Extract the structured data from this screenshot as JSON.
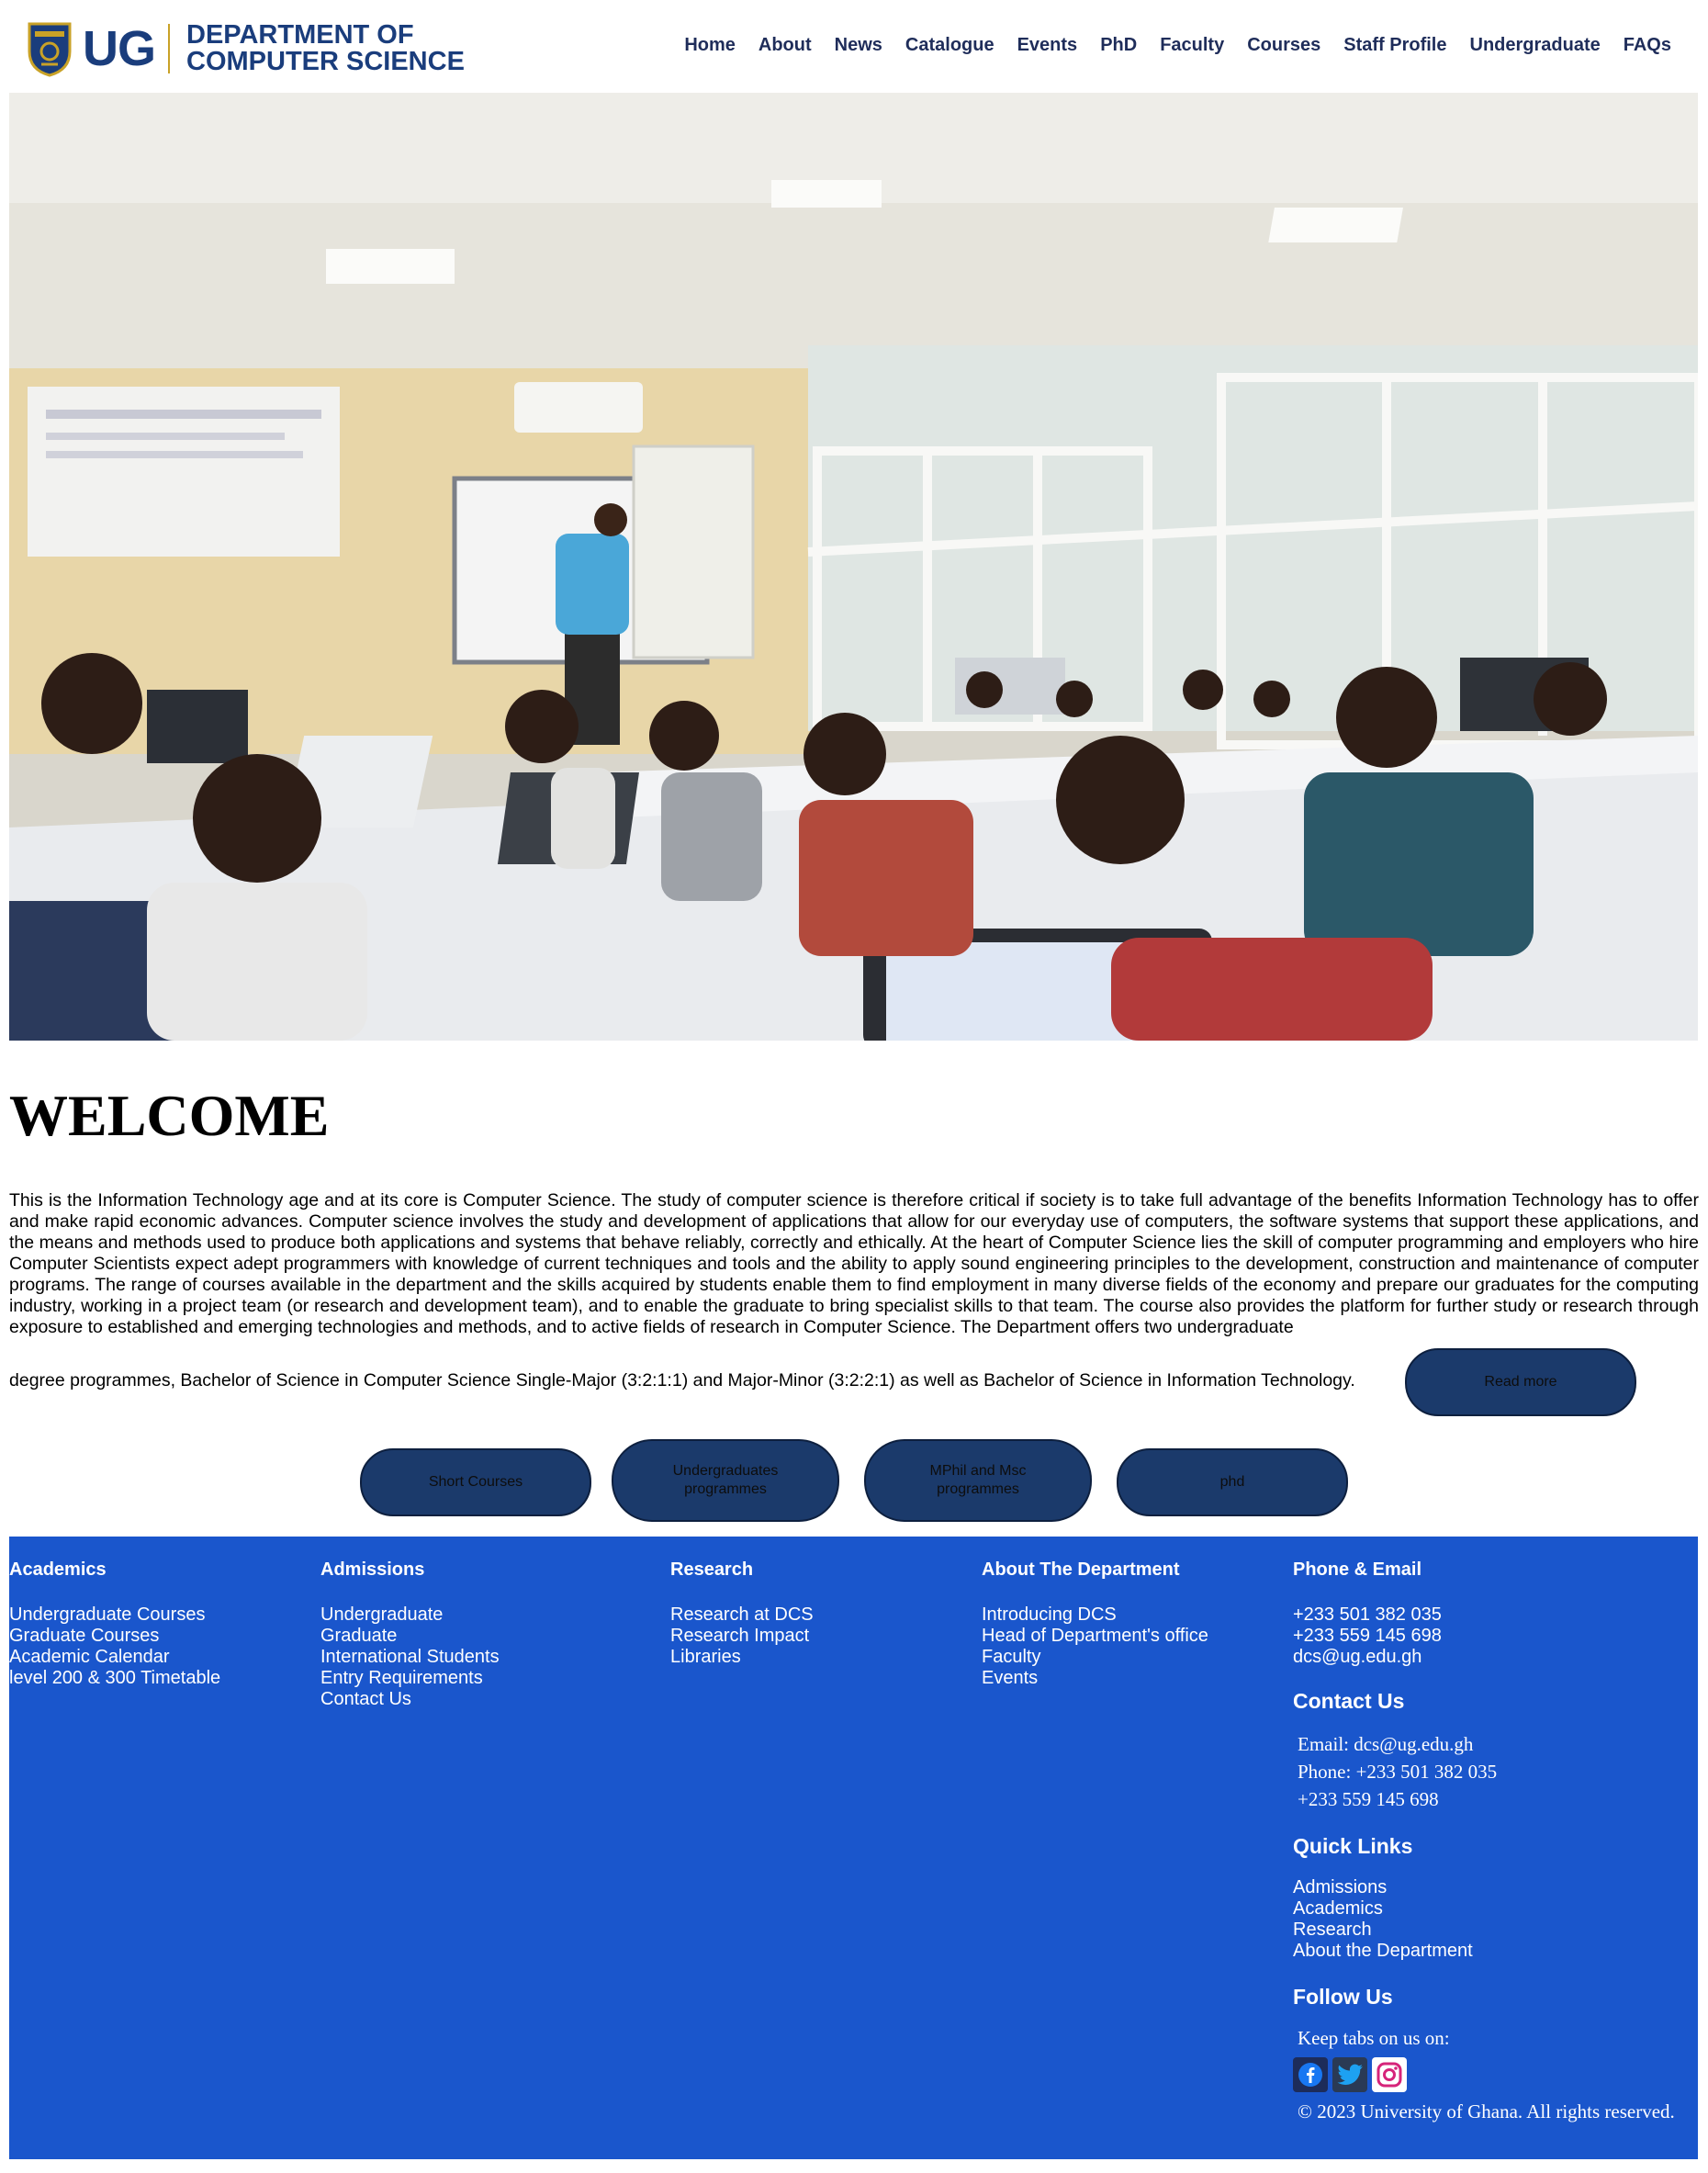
{
  "header": {
    "logo_mark": "UG",
    "dept_line1": "DEPARTMENT OF",
    "dept_line2": "COMPUTER SCIENCE",
    "nav": [
      "Home",
      "About",
      "News",
      "Catalogue",
      "Events",
      "PhD",
      "Faculty",
      "Courses",
      "Staff Profile",
      "Undergraduate",
      "FAQs"
    ]
  },
  "welcome": {
    "title": "WELCOME",
    "text": "This is the Information Technology age and at its core is Computer Science. The study of computer science is therefore critical if society is to take full advantage of the benefits Information Technology has to offer and make rapid economic advances. Computer science involves the study and development of applications that allow for our everyday use of computers, the software systems that support these applications, and the means and methods used to produce both applications and systems that behave reliably, correctly and ethically. At the heart of Computer Science lies the skill of computer programming and employers who hire Computer Scientists expect adept programmers with knowledge of current techniques and tools and the ability to apply sound engineering principles to the development, construction and maintenance of computer programs. The range of courses available in the department and the skills acquired by students enable them to find employment in many diverse fields of the economy and prepare our graduates for the computing industry, working in a project team (or research and development team), and to enable the graduate to bring specialist skills to that team. The course also provides the platform for further study or research through exposure to established and emerging technologies and methods, and to active fields of research in Computer Science. The Department offers two undergraduate",
    "text_last": "degree programmes, Bachelor of Science in Computer Science Single-Major (3:2:1:1) and Major-Minor (3:2:2:1) as well as Bachelor of Science in Information Technology.",
    "read_more": "Read more"
  },
  "programmes": [
    "Short Courses",
    "Undergraduates programmes",
    "MPhil and Msc programmes",
    "phd"
  ],
  "footer": {
    "academics": {
      "title": "Academics",
      "items": [
        "Undergraduate Courses",
        "Graduate Courses",
        "Academic Calendar",
        "level 200 & 300 Timetable"
      ]
    },
    "admissions": {
      "title": "Admissions",
      "items": [
        "Undergraduate",
        "Graduate",
        "International Students",
        "Entry Requirements",
        "Contact Us"
      ]
    },
    "research": {
      "title": "Research",
      "items": [
        "Research at DCS",
        "Research Impact",
        "Libraries"
      ]
    },
    "about": {
      "title": "About The Department",
      "items": [
        "Introducing DCS",
        "Head of Department's office",
        "Faculty",
        "Events"
      ]
    },
    "phone_email": {
      "title": "Phone & Email",
      "items": [
        "+233 501 382 035",
        "+233 559 145 698",
        "dcs@ug.edu.gh"
      ]
    },
    "contact": {
      "title": "Contact Us",
      "email": "Email: dcs@ug.edu.gh",
      "phone": "Phone: +233 501 382 035",
      "phone2": "+233 559 145 698"
    },
    "quick_links": {
      "title": "Quick Links",
      "items": [
        "Admissions",
        "Academics",
        "Research",
        "About the Department"
      ]
    },
    "follow": {
      "title": "Follow Us",
      "text": "Keep tabs on us on:",
      "icons": [
        "facebook-icon",
        "twitter-icon",
        "instagram-icon"
      ]
    },
    "copyright": "© 2023 University of Ghana. All rights reserved."
  },
  "colors": {
    "brand": "#1a3d7c",
    "footer": "#1a56cc",
    "button": "#1b3a6b"
  }
}
